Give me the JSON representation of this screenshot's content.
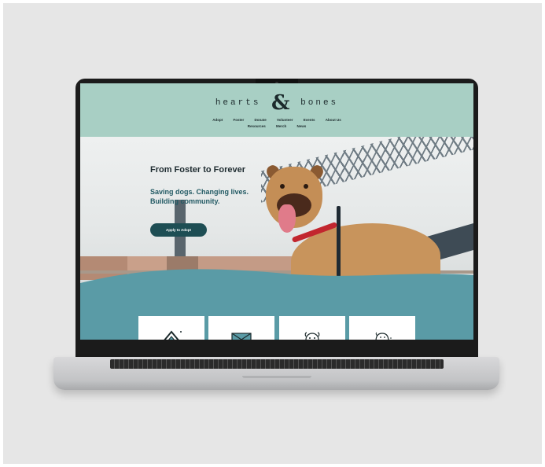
{
  "site": {
    "logo_word_1": "hearts",
    "logo_amp": "&",
    "logo_word_2": "bones",
    "nav": [
      "Adopt",
      "Foster",
      "Donate",
      "Volunteer",
      "Events",
      "About Us",
      "Resources",
      "Merch",
      "News"
    ]
  },
  "hero": {
    "title": "From Foster to Forever",
    "subtitle_line_1": "Saving dogs. Changing lives.",
    "subtitle_line_2": "Building community.",
    "cta_label": "Apply to Adopt"
  },
  "cards": [
    {
      "icon": "house-icon"
    },
    {
      "icon": "envelope-icon"
    },
    {
      "icon": "dog-face-icon"
    },
    {
      "icon": "dog-sketch-icon"
    }
  ],
  "colors": {
    "header_bg": "#a8cfc4",
    "teal_section": "#5a9ba6",
    "button_bg": "#1e4e54",
    "subtitle": "#235a64"
  }
}
